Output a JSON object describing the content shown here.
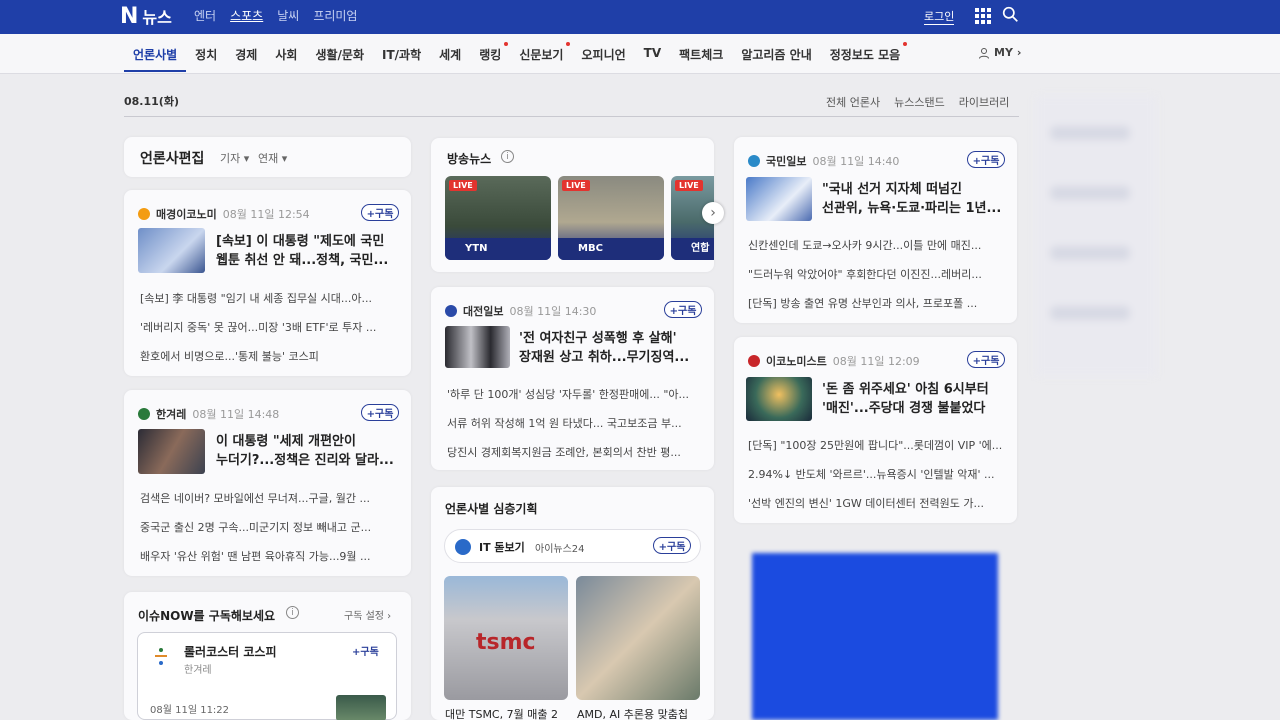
{
  "brand": {
    "n": "N",
    "text": "뉴스"
  },
  "topnav": [
    "엔터",
    "스포츠",
    "날씨",
    "프리미엄"
  ],
  "login": "로그인",
  "categories": [
    "언론사별",
    "정치",
    "경제",
    "사회",
    "생활/문화",
    "IT/과학",
    "세계",
    "랭킹",
    "신문보기",
    "오피니언",
    "TV",
    "팩트체크",
    "알고리즘 안내",
    "정정보도 모음"
  ],
  "my": "MY",
  "date": "08.11(화)",
  "toplinks": [
    "전체 언론사",
    "뉴스스탠드",
    "라이브러리"
  ],
  "editor": {
    "title": "언론사편집",
    "filter1": "기자",
    "filter2": "연재"
  },
  "subscribe": "+구독",
  "card1": {
    "pub": "매경이코노미",
    "time": "08월 11일 12:54",
    "head1": "[속보] 이 대통령 \"제도에 국민",
    "head2": "웹툰 취선 안 돼...정책, 국민...",
    "lines": [
      "[속보] 李 대통령 \"임기 내 세종 집무실 시대...아...",
      "'레버리지 중독' 못 끊어...미장 '3배 ETF'로 투자 ...",
      "환호에서 비명으로...'통제 불능' 코스피"
    ]
  },
  "card2": {
    "pub": "한겨레",
    "time": "08월 11일 14:48",
    "head1": "이 대통령 \"세제 개편안이",
    "head2": "누더기?...정책은 진리와 달라...",
    "lines": [
      "검색은 네이버? 모바일에선 무너져...구글, 월간 ...",
      "중국군 출신 2명 구속...미군기지 정보 빼내고 군...",
      "배우자 '유산 위험' 땐 남편 육아휴직 가능...9월 ..."
    ]
  },
  "issue": {
    "title": "이슈NOW를 구독해보세요",
    "setting": "구독 설정",
    "item_title": "롤러코스터 코스피",
    "item_pub": "한겨레",
    "item_time": "08월 11일 11:22"
  },
  "broadcast": {
    "title": "방송뉴스",
    "live": "LIVE",
    "ch1": "YTN",
    "ch2": "MBC",
    "ch3": "연합"
  },
  "card3": {
    "pub": "대전일보",
    "time": "08월 11일 14:30",
    "head1": "'전 여자친구 성폭행 후 살해'",
    "head2": "장재원 상고 취하...무기징역...",
    "lines": [
      "'하루 단 100개' 성심당 '자두롤' 한정판매에... \"아...",
      "서류 허위 작성해 1억 원 타냈다... 국고보조금 부...",
      "당진시 경제회복지원금 조례안, 본회의서 찬반 평..."
    ]
  },
  "special": {
    "title": "언론사별 심층기획",
    "series": "IT 돋보기",
    "pub": "아이뉴스24",
    "cap1": "대만 TSMC, 7월 매출 2",
    "cap2": "AMD, AI 추론용 맞춤칩",
    "sign": "tsmc"
  },
  "card4": {
    "pub": "국민일보",
    "time": "08월 11일 14:40",
    "head1": "\"국내 선거 지자체 떠넘긴",
    "head2": "선관위, 뉴욕·도쿄·파리는 1년...",
    "lines": [
      "신칸센인데 도쿄→오사카 9시간...이틀 만에 매진...",
      "\"드러누워 악았어야\" 후회한다던 이진진...레버리...",
      "[단독] 방송 출연 유명 산부인과 의사, 프로포폴 ..."
    ]
  },
  "card5": {
    "pub": "이코노미스트",
    "time": "08월 11일 12:09",
    "head1": "'돈 좀 위주세요' 아침 6시부터",
    "head2": "'매진'...주당대 경쟁 불붙었다",
    "lines": [
      "[단독] \"100장 25만원에 팝니다\"...롯데껌이 VIP '에...",
      "2.94%↓ 반도체 '와르르'...뉴욕증시 '인텔발 악재' ...",
      "'선박 엔진의 변신' 1GW 데이터센터 전력원도 가..."
    ]
  }
}
